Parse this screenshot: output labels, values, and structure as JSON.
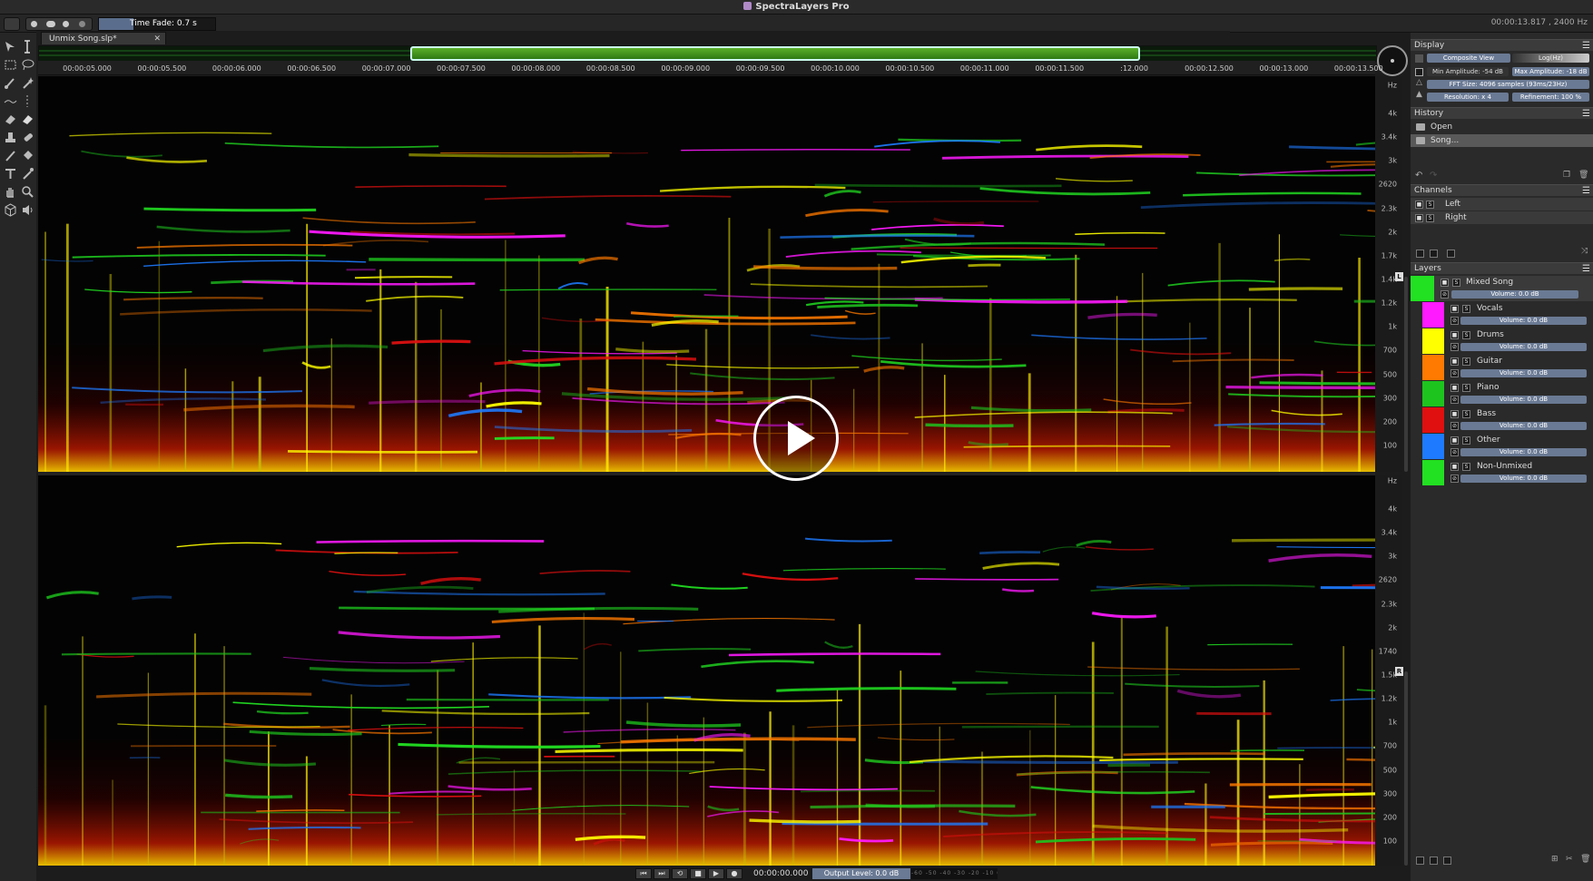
{
  "app": {
    "title": "SpectraLayers Pro"
  },
  "toolbar": {
    "time_fade_label": "Time Fade: 0.7 s",
    "time_fade_level": 0.3,
    "cursor_readout": "00:00:13.817 , 2400 Hz"
  },
  "tab": {
    "label": "Unmix Song.slp*",
    "close": "✕"
  },
  "overview": {
    "selection_start_fraction": 0.278,
    "selection_end_fraction": 0.8235
  },
  "ruler": {
    "ticks": [
      "00:00:05.000",
      "00:00:05.500",
      "00:00:06.000",
      "00:00:06.500",
      "00:00:07.000",
      "00:00:07.500",
      "00:00:08.000",
      "00:00:08.500",
      "00:00:09.000",
      "00:00:09.500",
      "00:00:10.000",
      "00:00:10.500",
      "00:00:11.000",
      "00:00:11.500",
      ":12.000",
      "00:00:12.500",
      "00:00:13.000",
      "00:00:13.500"
    ]
  },
  "freq_axis": {
    "unit": "Hz",
    "top_labels": [
      "4k",
      "3.4k",
      "3k",
      "2620",
      "2.3k",
      "2k",
      "1.7k",
      "1.4k",
      "1.2k",
      "1k",
      "700",
      "500",
      "300",
      "200",
      "100"
    ],
    "bottom_labels": [
      "4k",
      "3.4k",
      "3k",
      "2620",
      "2.3k",
      "2k",
      "1740",
      "1.5k",
      "1.2k",
      "1k",
      "700",
      "500",
      "300",
      "200",
      "100"
    ],
    "left_channel": "L",
    "right_channel": "R"
  },
  "display_panel": {
    "title": "Display",
    "view_mode": "Composite View",
    "scale": "Log(Hz)",
    "min_amplitude": "Min Amplitude: -54 dB",
    "max_amplitude": "Max Amplitude: -18 dB",
    "fft_size": "FFT Size: 4096 samples (93ms/23Hz)",
    "resolution": "Resolution: x 4",
    "refinement": "Refinement: 100 %"
  },
  "history_panel": {
    "title": "History",
    "items": [
      "Open",
      "Song..."
    ]
  },
  "channels_panel": {
    "title": "Channels",
    "items": [
      "Left",
      "Right"
    ]
  },
  "layers_panel": {
    "title": "Layers",
    "master": {
      "name": "Mixed Song",
      "volume": "Volume: 0.0 dB",
      "color": "#22e022"
    },
    "layers": [
      {
        "name": "Vocals",
        "volume": "Volume: 0.0 dB",
        "color": "#ff1aff"
      },
      {
        "name": "Drums",
        "volume": "Volume: 0.0 dB",
        "color": "#ffff00"
      },
      {
        "name": "Guitar",
        "volume": "Volume: 0.0 dB",
        "color": "#ff7a00"
      },
      {
        "name": "Piano",
        "volume": "Volume: 0.0 dB",
        "color": "#1ec41e"
      },
      {
        "name": "Bass",
        "volume": "Volume: 0.0 dB",
        "color": "#e01010"
      },
      {
        "name": "Other",
        "volume": "Volume: 0.0 dB",
        "color": "#1e7bff"
      },
      {
        "name": "Non-Unmixed",
        "volume": "Volume: 0.0 dB",
        "color": "#22e022"
      }
    ]
  },
  "transport": {
    "timecode": "00:00:00.000",
    "output_level": "Output Level: 0.0 dB",
    "meter_scale": "-60 -50 -40 -30 -20 -10 0"
  },
  "colors": {
    "accent": "#6a7a94",
    "background": "#1c1c1c",
    "spectrum_bg": "#030303"
  }
}
